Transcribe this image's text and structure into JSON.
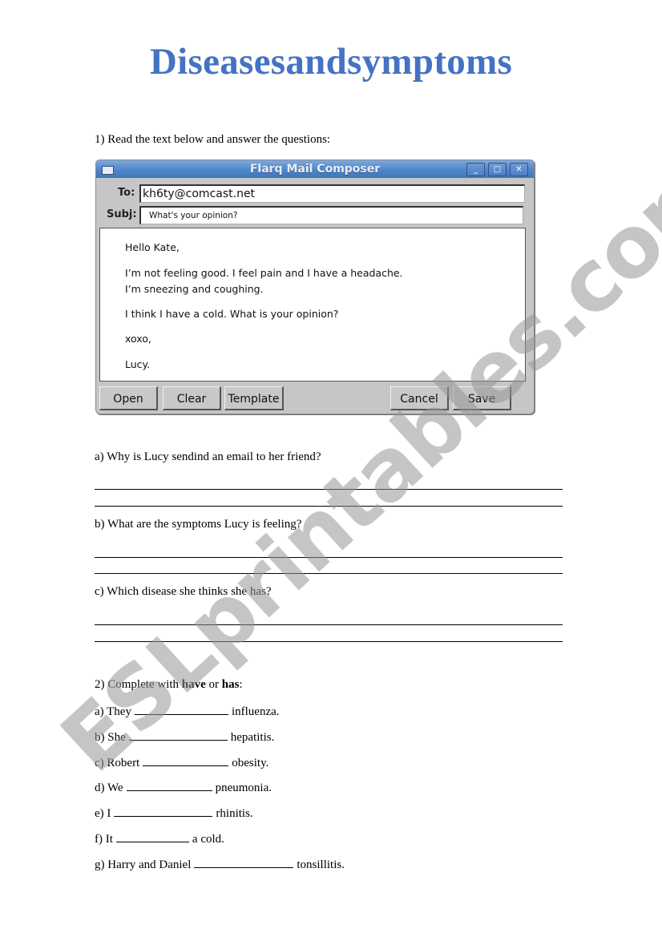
{
  "title": "Diseasesandsymptoms",
  "section1": {
    "instruction": "1) Read the text below and answer the questions:"
  },
  "mail_window": {
    "title": "Flarq Mail Composer",
    "window_icon": "window-menu-icon",
    "controls": {
      "minimize": "_",
      "maximize": "□",
      "close": "✕"
    },
    "to_label": "To:",
    "to_value": "kh6ty@comcast.net",
    "subj_label": "Subj:",
    "subj_value": "What's your opinion?",
    "body_lines": [
      "Hello Kate,",
      "I’m not feeling good. I feel pain and I have a headache.",
      "I’m sneezing and coughing.",
      "I think I have a cold.  What is your opinion?",
      "xoxo,",
      "Lucy."
    ],
    "buttons": {
      "open": "Open",
      "clear": "Clear",
      "template": "Template",
      "cancel": "Cancel",
      "save": "Save"
    }
  },
  "questions": [
    "a) Why is Lucy sendind an email to her friend?",
    "b) What are the symptoms Lucy is feeling?",
    "c) Which disease she thinks she has?"
  ],
  "section2": {
    "instruction_prefix": "2) Complete with ",
    "word1": "have",
    "middle": " or ",
    "word2": "has",
    "suffix": ":",
    "items": [
      {
        "before": "a) They",
        "after": "influenza."
      },
      {
        "before": "b) She",
        "after": "hepatitis."
      },
      {
        "before": "c) Robert",
        "after": "obesity."
      },
      {
        "before": "d) We",
        "after": "pneumonia."
      },
      {
        "before": "e) I",
        "after": "rhinitis."
      },
      {
        "before": "f) It",
        "after": "a cold."
      },
      {
        "before": "g) Harry and Daniel",
        "after": "tonsillitis."
      }
    ]
  },
  "watermark": "ESLprintables.com",
  "colors": {
    "title": "#4472c4",
    "titlebar": "#4f86c9",
    "window_bg": "#c6c6c6"
  }
}
